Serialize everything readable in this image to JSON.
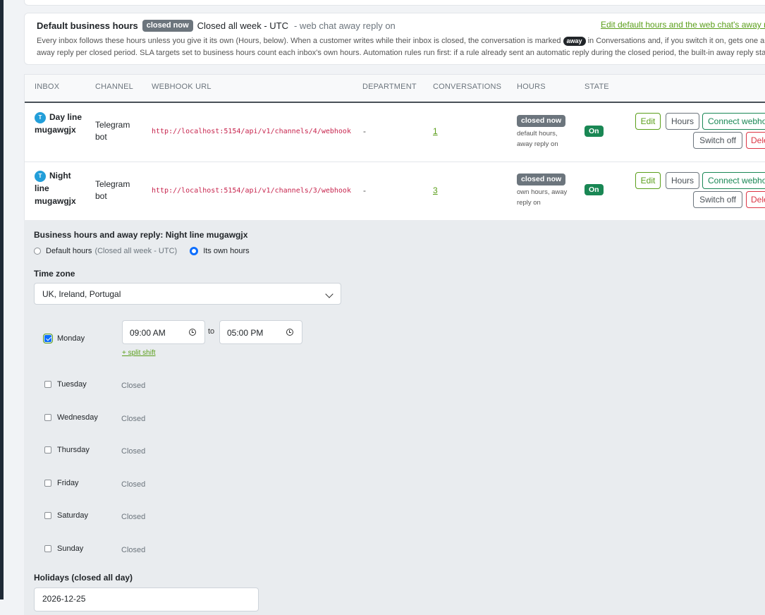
{
  "default_hours": {
    "title": "Default business hours",
    "status_badge": "closed now",
    "summary": "Closed all week - UTC",
    "sub": "- web chat away reply on",
    "edit_link": "Edit default hours and the web chat's away reply",
    "desc_part1": "Every inbox follows these hours unless you give it its own (Hours, below). When a customer writes while their inbox is closed, the conversation is marked ",
    "desc_badge": "away",
    "desc_part2": " in Conversations and, if you switch it on, gets one automatic away reply per closed period. SLA targets set to business hours count each inbox's own hours. Automation rules run first: if a rule already sent an automatic reply during the closed period, the built-in away reply stays quiet."
  },
  "table": {
    "headers": {
      "inbox": "INBOX",
      "channel": "CHANNEL",
      "webhook": "WEBHOOK URL",
      "department": "DEPARTMENT",
      "conversations": "CONVERSATIONS",
      "hours": "HOURS",
      "state": "STATE"
    },
    "rows": [
      {
        "avatar": "T",
        "name": "Day line mugawgjx",
        "channel": "Telegram bot",
        "webhook": "http://localhost:5154/api/v1/channels/4/webhook",
        "department": "-",
        "conversations": "1",
        "hours_badge": "closed now",
        "hours_note": "default hours, away reply on",
        "state": "On",
        "actions": {
          "edit": "Edit",
          "hours": "Hours",
          "connect": "Connect webhook",
          "switch": "Switch off",
          "delete": "Delete"
        }
      },
      {
        "avatar": "T",
        "name": "Night line mugawgjx",
        "channel": "Telegram bot",
        "webhook": "http://localhost:5154/api/v1/channels/3/webhook",
        "department": "-",
        "conversations": "3",
        "hours_badge": "closed now",
        "hours_note": "own hours, away reply on",
        "state": "On",
        "actions": {
          "edit": "Edit",
          "hours": "Hours",
          "connect": "Connect webhook",
          "switch": "Switch off",
          "delete": "Delete"
        }
      }
    ]
  },
  "editor": {
    "title": "Business hours and away reply: Night line mugawgjx",
    "radio_default": "Default hours",
    "radio_default_hint": "(Closed all week - UTC)",
    "radio_own": "Its own hours",
    "selected_radio": "own",
    "timezone_label": "Time zone",
    "timezone_value": "UK, Ireland, Portugal",
    "days": [
      {
        "name": "Monday",
        "checked": true,
        "from": "09:00 AM",
        "to": "05:00 PM"
      },
      {
        "name": "Tuesday",
        "checked": false,
        "status": "Closed"
      },
      {
        "name": "Wednesday",
        "checked": false,
        "status": "Closed"
      },
      {
        "name": "Thursday",
        "checked": false,
        "status": "Closed"
      },
      {
        "name": "Friday",
        "checked": false,
        "status": "Closed"
      },
      {
        "name": "Saturday",
        "checked": false,
        "status": "Closed"
      },
      {
        "name": "Sunday",
        "checked": false,
        "status": "Closed"
      }
    ],
    "to_label": "to",
    "split_shift": "+ split shift",
    "holidays_label": "Holidays (closed all day)",
    "holiday_value": "2026-12-25"
  }
}
